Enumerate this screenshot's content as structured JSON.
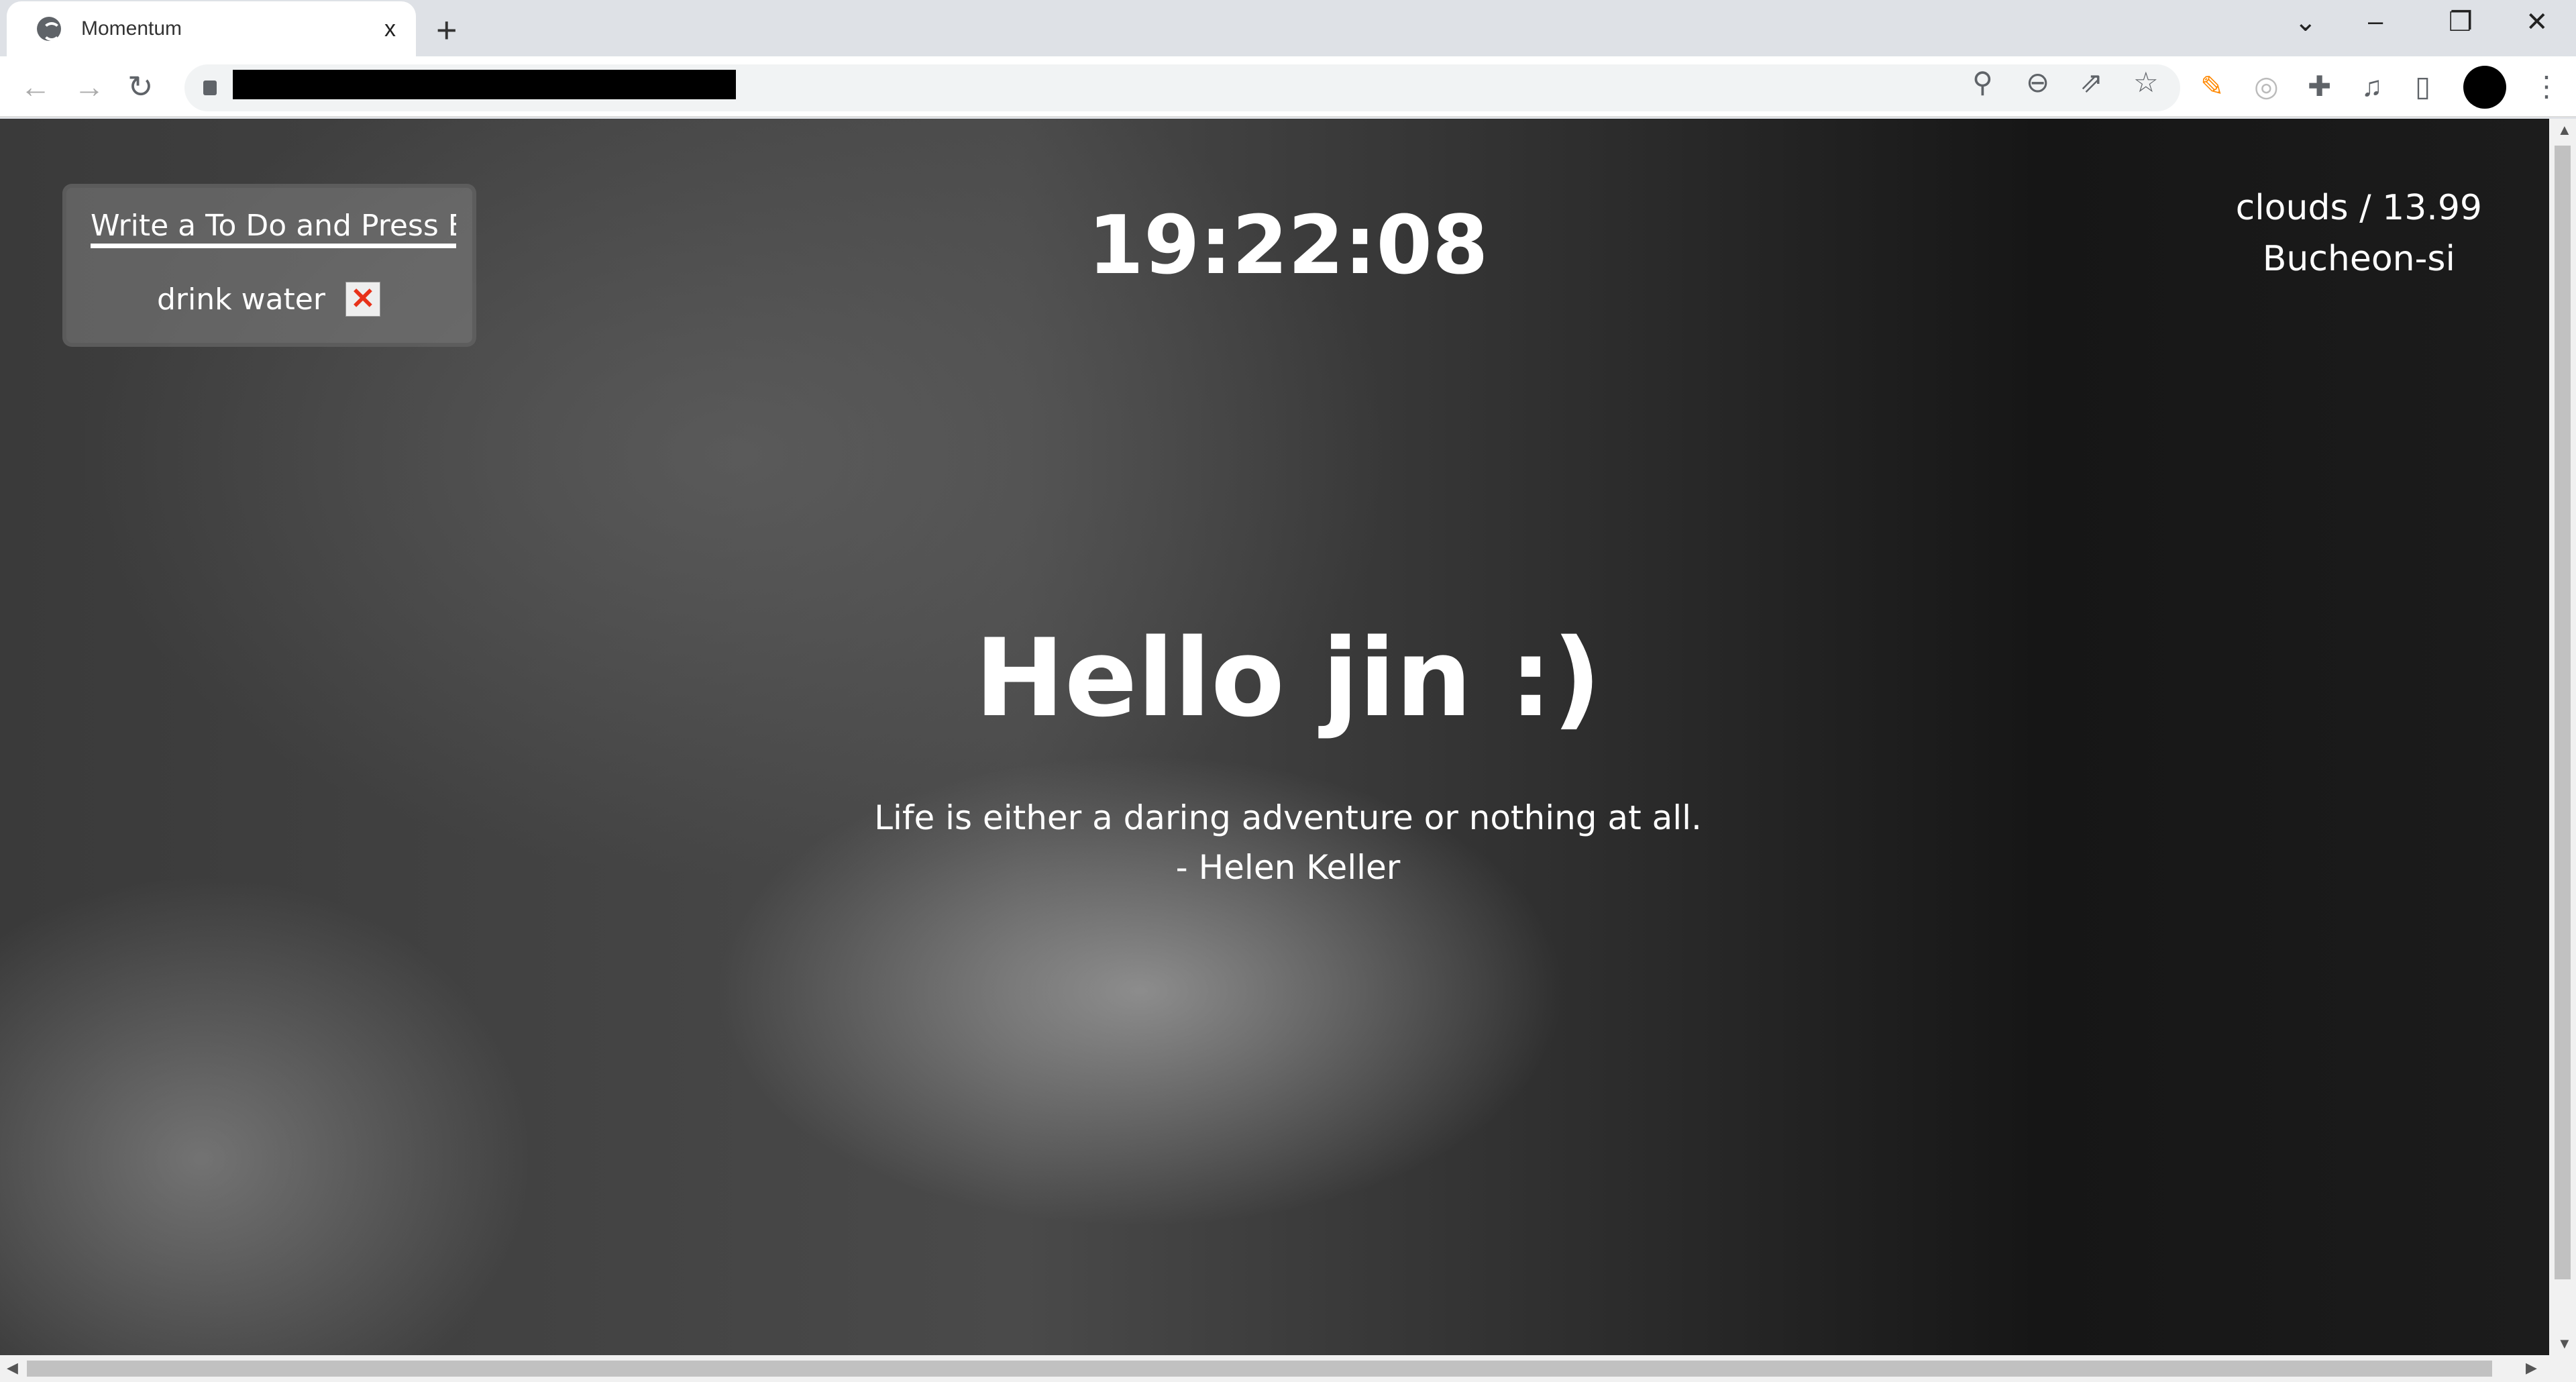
{
  "browser": {
    "tab_title": "Momentum",
    "new_tab": "+",
    "tab_close": "x"
  },
  "todo": {
    "placeholder": "Write a To Do and Press Enter",
    "items": [
      {
        "text": "drink water",
        "delete": "✕"
      }
    ]
  },
  "clock": "19:22:08",
  "weather": {
    "line1": "clouds / 13.99",
    "city": "Bucheon-si"
  },
  "greeting": "Hello jin :)",
  "quote": {
    "text": "Life is either a daring adventure or nothing at all.",
    "author": "- Helen Keller"
  }
}
